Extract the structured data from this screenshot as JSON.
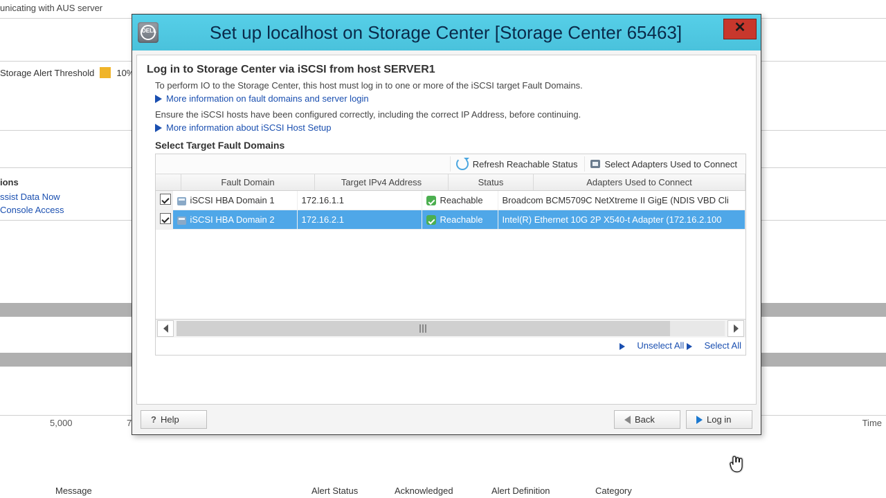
{
  "bg": {
    "status_line": "unicating with AUS server",
    "alert_threshold_label": "Storage Alert Threshold",
    "alert_threshold_value": "10%",
    "left_header": "ions",
    "link_assist": "ssist Data Now",
    "link_console": "Console Access",
    "axis_5000": "5,000",
    "axis_7": "7",
    "axis_time": "Time",
    "table_headers": {
      "message": "Message",
      "alert_status": "Alert Status",
      "acknowledged": "Acknowledged",
      "alert_definition": "Alert Definition",
      "category": "Category"
    }
  },
  "dialog": {
    "title": "Set up localhost on Storage Center [Storage Center 65463]",
    "heading": "Log in to Storage Center via iSCSI from host SERVER1",
    "para1": "To perform IO to the Storage Center, this host must log in to one or more of the iSCSI target Fault Domains.",
    "link1": "More information on fault domains and server login",
    "para2": "Ensure the iSCSI hosts have been configured correctly, including the correct IP Address, before continuing.",
    "link2": "More information about iSCSI Host Setup",
    "select_heading": "Select Target Fault Domains",
    "toolbar": {
      "refresh": "Refresh Reachable Status",
      "select_adapters": "Select Adapters Used to Connect"
    },
    "columns": {
      "fault_domain": "Fault Domain",
      "target_ip": "Target IPv4 Address",
      "status": "Status",
      "adapters": "Adapters Used to Connect"
    },
    "rows": [
      {
        "checked": true,
        "name": "iSCSI HBA Domain 1",
        "ip": "172.16.1.1",
        "status": "Reachable",
        "adapter": "Broadcom BCM5709C NetXtreme II GigE (NDIS VBD Cli"
      },
      {
        "checked": true,
        "name": "iSCSI HBA Domain 2",
        "ip": "172.16.2.1",
        "status": "Reachable",
        "adapter": "Intel(R) Ethernet 10G 2P X540-t Adapter (172.16.2.100"
      }
    ],
    "unselect_all": "Unselect All",
    "select_all": "Select All",
    "buttons": {
      "help": "Help",
      "back": "Back",
      "login": "Log in"
    }
  }
}
